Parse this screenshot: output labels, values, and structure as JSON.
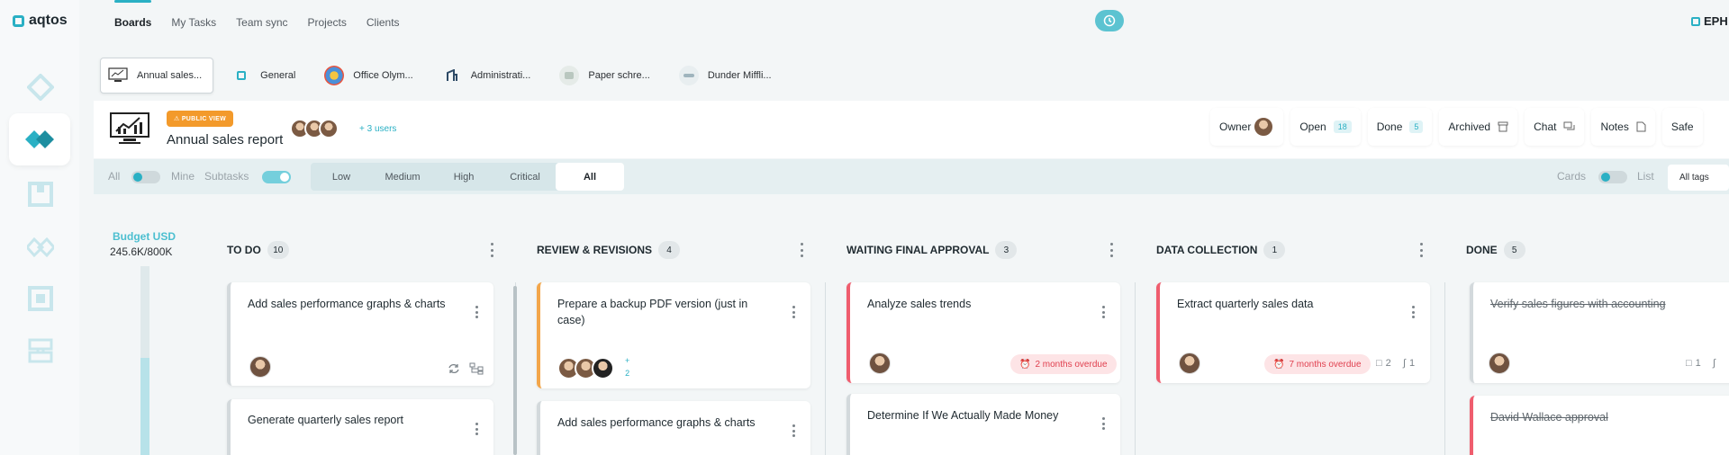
{
  "app": {
    "logo_text": "aqtos",
    "user_label": "EPH"
  },
  "nav": {
    "tabs": [
      "Boards",
      "My Tasks",
      "Team sync",
      "Projects",
      "Clients"
    ],
    "active": "Boards"
  },
  "board_tabs": [
    {
      "label": "Annual sales...",
      "icon": "monitor-chart-icon",
      "active": true
    },
    {
      "label": "General",
      "icon": "aqtos-logo-icon",
      "active": false
    },
    {
      "label": "Office Olym...",
      "icon": "olympics-icon",
      "active": false
    },
    {
      "label": "Administrati...",
      "icon": "admin-icon",
      "active": false
    },
    {
      "label": "Paper schre...",
      "icon": "paper-shredder-icon",
      "active": false
    },
    {
      "label": "Dunder Miffli...",
      "icon": "dunder-mifflin-icon",
      "active": false
    }
  ],
  "board": {
    "badge": "PUBLIC VIEW",
    "title": "Annual sales report",
    "more_users": "+ 3 users"
  },
  "header_pills": {
    "owner": "Owner",
    "open": "Open",
    "open_count": "18",
    "done": "Done",
    "done_count": "5",
    "archived": "Archived",
    "chat": "Chat",
    "notes": "Notes",
    "safe": "Safe"
  },
  "filters": {
    "all": "All",
    "mine": "Mine",
    "subtasks": "Subtasks",
    "priorities": [
      "Low",
      "Medium",
      "High",
      "Critical",
      "All"
    ],
    "active_priority": "All",
    "cards": "Cards",
    "list": "List",
    "all_tags": "All tags"
  },
  "budget": {
    "label": "Budget USD",
    "value": "245.6K/800K",
    "fraction": 0.307
  },
  "columns": [
    {
      "title": "TO DO",
      "count": "10"
    },
    {
      "title": "REVIEW & REVISIONS",
      "count": "4"
    },
    {
      "title": "WAITING FINAL APPROVAL",
      "count": "3"
    },
    {
      "title": "DATA COLLECTION",
      "count": "1"
    },
    {
      "title": "DONE",
      "count": "5"
    }
  ],
  "cards": {
    "todo_1": "Add sales performance graphs & charts",
    "todo_2": "Generate quarterly sales report",
    "review_1": "Prepare a backup PDF version (just in case)",
    "review_1_more": "+",
    "review_1_more_count": "2",
    "review_2": "Add sales performance graphs & charts",
    "waiting_1": "Analyze sales trends",
    "waiting_1_overdue": "2 months overdue",
    "waiting_2": "Determine If We Actually Made Money",
    "data_1": "Extract quarterly sales data",
    "data_1_overdue": "7 months overdue",
    "data_1_comments": "2",
    "data_1_attachments": "1",
    "done_1": "Verify sales figures with accounting",
    "done_1_comments": "1",
    "done_2": "David Wallace approval"
  },
  "colors": {
    "accent": "#2ab0c4",
    "orange": "#f39a2b",
    "red": "#ef5d6e"
  }
}
